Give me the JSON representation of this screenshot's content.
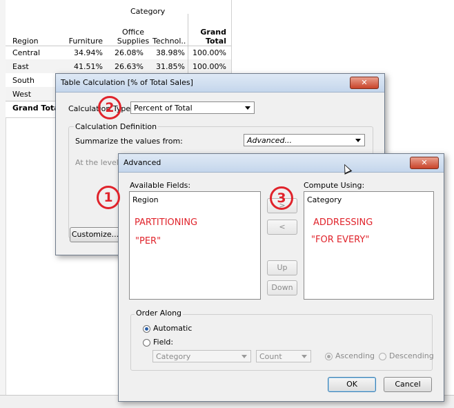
{
  "crosstab": {
    "column_group_header": "Category",
    "headers": {
      "region": "Region",
      "furniture": "Furniture",
      "office_line1": "Office",
      "office_line2": "Supplies",
      "technology": "Technol..",
      "grand_line1": "Grand",
      "grand_line2": "Total"
    },
    "rows": [
      {
        "region": "Central",
        "furniture": "34.94%",
        "office": "26.08%",
        "technology": "38.98%",
        "grand": "100.00%"
      },
      {
        "region": "East",
        "furniture": "41.51%",
        "office": "26.63%",
        "technology": "31.85%",
        "grand": "100.00%"
      },
      {
        "region": "South"
      },
      {
        "region": "West"
      },
      {
        "region": "Grand Total"
      }
    ]
  },
  "table_calc_dialog": {
    "title": "Table Calculation [% of Total Sales]",
    "calc_type_label": "Calculation Type:",
    "calc_type_value": "Percent of Total",
    "definition_label": "Calculation Definition",
    "summarize_label": "Summarize the values from:",
    "summarize_value": "Advanced...",
    "at_level_label": "At the level:",
    "customize_button": "Customize...",
    "close_symbol": "✕"
  },
  "advanced_dialog": {
    "title": "Advanced",
    "close_symbol": "✕",
    "available_fields_label": "Available Fields:",
    "available_fields": [
      "Region"
    ],
    "compute_using_label": "Compute Using:",
    "compute_using": [
      "Category"
    ],
    "move_right_button": ">",
    "move_left_button": "<",
    "up_button": "Up",
    "down_button": "Down",
    "order_along_label": "Order Along",
    "automatic_label": "Automatic",
    "field_label": "Field:",
    "field_select_value": "Category",
    "agg_select_value": "Count",
    "ascending_label": "Ascending",
    "descending_label": "Descending",
    "ok_button": "OK",
    "cancel_button": "Cancel",
    "selected_order": "Automatic",
    "selected_sort": "Ascending"
  },
  "annotations": {
    "num1": "1",
    "num2": "2",
    "num3": "3",
    "partitioning": "PARTITIONING",
    "per": "\"PER\"",
    "addressing": "ADDRESSING",
    "for_every": "\"FOR EVERY\""
  },
  "colors": {
    "annotation": "#e0232b",
    "titlebar": "#c4d6ec",
    "close_button": "#c9432a"
  }
}
